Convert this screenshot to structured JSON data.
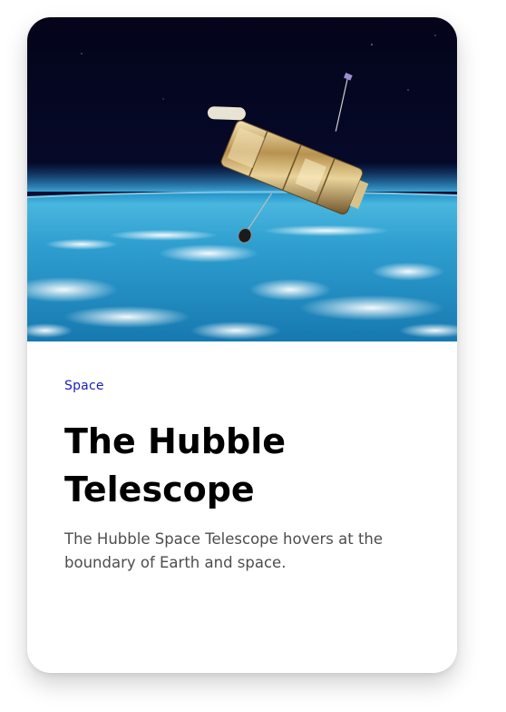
{
  "card": {
    "image": {
      "subject": "hubble-telescope-over-earth"
    },
    "category": "Space",
    "title": "The Hubble Telescope",
    "description": "The Hubble Space Telescope hovers at the boundary of Earth and space.",
    "colors": {
      "category": "#1a22b8",
      "title": "#000000",
      "description": "#4d4d4d"
    }
  }
}
